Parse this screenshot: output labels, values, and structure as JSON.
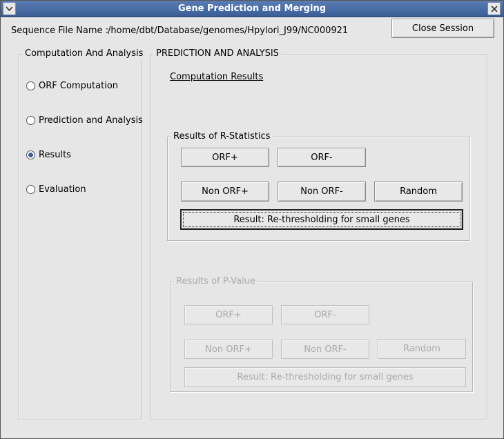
{
  "window": {
    "title": "Gene Prediction and Merging"
  },
  "header": {
    "sequence_label": "Sequence File Name :",
    "sequence_path": "/home/dbt/Database/genomes/Hpylori_J99/NC000921",
    "close_session_label": "Close Session"
  },
  "left_panel": {
    "title": "Computation And Analysis",
    "options": [
      {
        "label": "ORF Computation",
        "checked": false
      },
      {
        "label": "Prediction and Analysis",
        "checked": false
      },
      {
        "label": "Results",
        "checked": true
      },
      {
        "label": "Evaluation",
        "checked": false
      }
    ]
  },
  "right_panel": {
    "title": "PREDICTION AND ANALYSIS",
    "subheading": "Computation Results",
    "r_statistics": {
      "title": "Results of R-Statistics",
      "orf_plus": "ORF+",
      "orf_minus": "ORF-",
      "non_orf_plus": "Non ORF+",
      "non_orf_minus": "Non ORF-",
      "random": "Random",
      "rethreshold": "Result:  Re-thresholding for small genes"
    },
    "p_value": {
      "title": "Results of P-Value",
      "orf_plus": "ORF+",
      "orf_minus": "ORF-",
      "non_orf_plus": "Non ORF+",
      "non_orf_minus": "Non ORF-",
      "random": "Random",
      "rethreshold": "Result:  Re-thresholding for small genes"
    }
  },
  "colors": {
    "titlebar": "#3a5d95",
    "background": "#e6e6e6",
    "disabled_text": "#aaaaaa"
  },
  "icons": {
    "menu": "chevron-down-icon",
    "close": "close-icon"
  }
}
